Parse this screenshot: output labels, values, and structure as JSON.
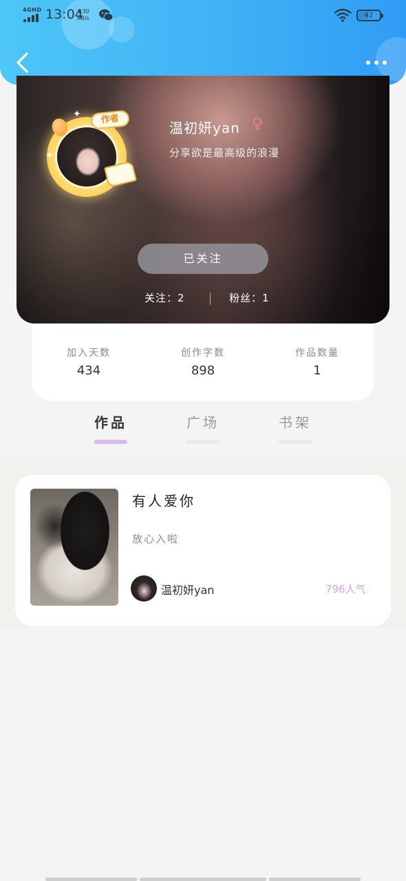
{
  "status_bar": {
    "network": "4GHD",
    "time": "13:04",
    "speed_value": "4.30",
    "speed_unit": "KB/s",
    "battery": "42"
  },
  "header": {
    "back_icon": "chevron-left-icon",
    "more_icon": "more-horizontal-icon"
  },
  "profile": {
    "badge": "作者",
    "nickname": "温初妍yan",
    "gender_symbol": "♀",
    "bio": "分享欲是最高级的浪漫",
    "follow_button": "已关注",
    "following": "关注：2",
    "fans": "粉丝：1"
  },
  "stats": [
    {
      "label": "加入天数",
      "value": "434"
    },
    {
      "label": "创作字数",
      "value": "898"
    },
    {
      "label": "作品数量",
      "value": "1"
    }
  ],
  "tabs": [
    {
      "label": "作品",
      "active": true
    },
    {
      "label": "广场",
      "active": false
    },
    {
      "label": "书架",
      "active": false
    }
  ],
  "works": [
    {
      "title": "有人爱你",
      "description": "放心入啦",
      "author": "温初妍yan",
      "popularity": "796人气"
    }
  ],
  "colors": {
    "header_blue": "#3fb2f6",
    "tab_active_bar": "#d6b9f2",
    "popularity_purple": "#cfa6ea",
    "gender_pink": "#e87ba2"
  }
}
